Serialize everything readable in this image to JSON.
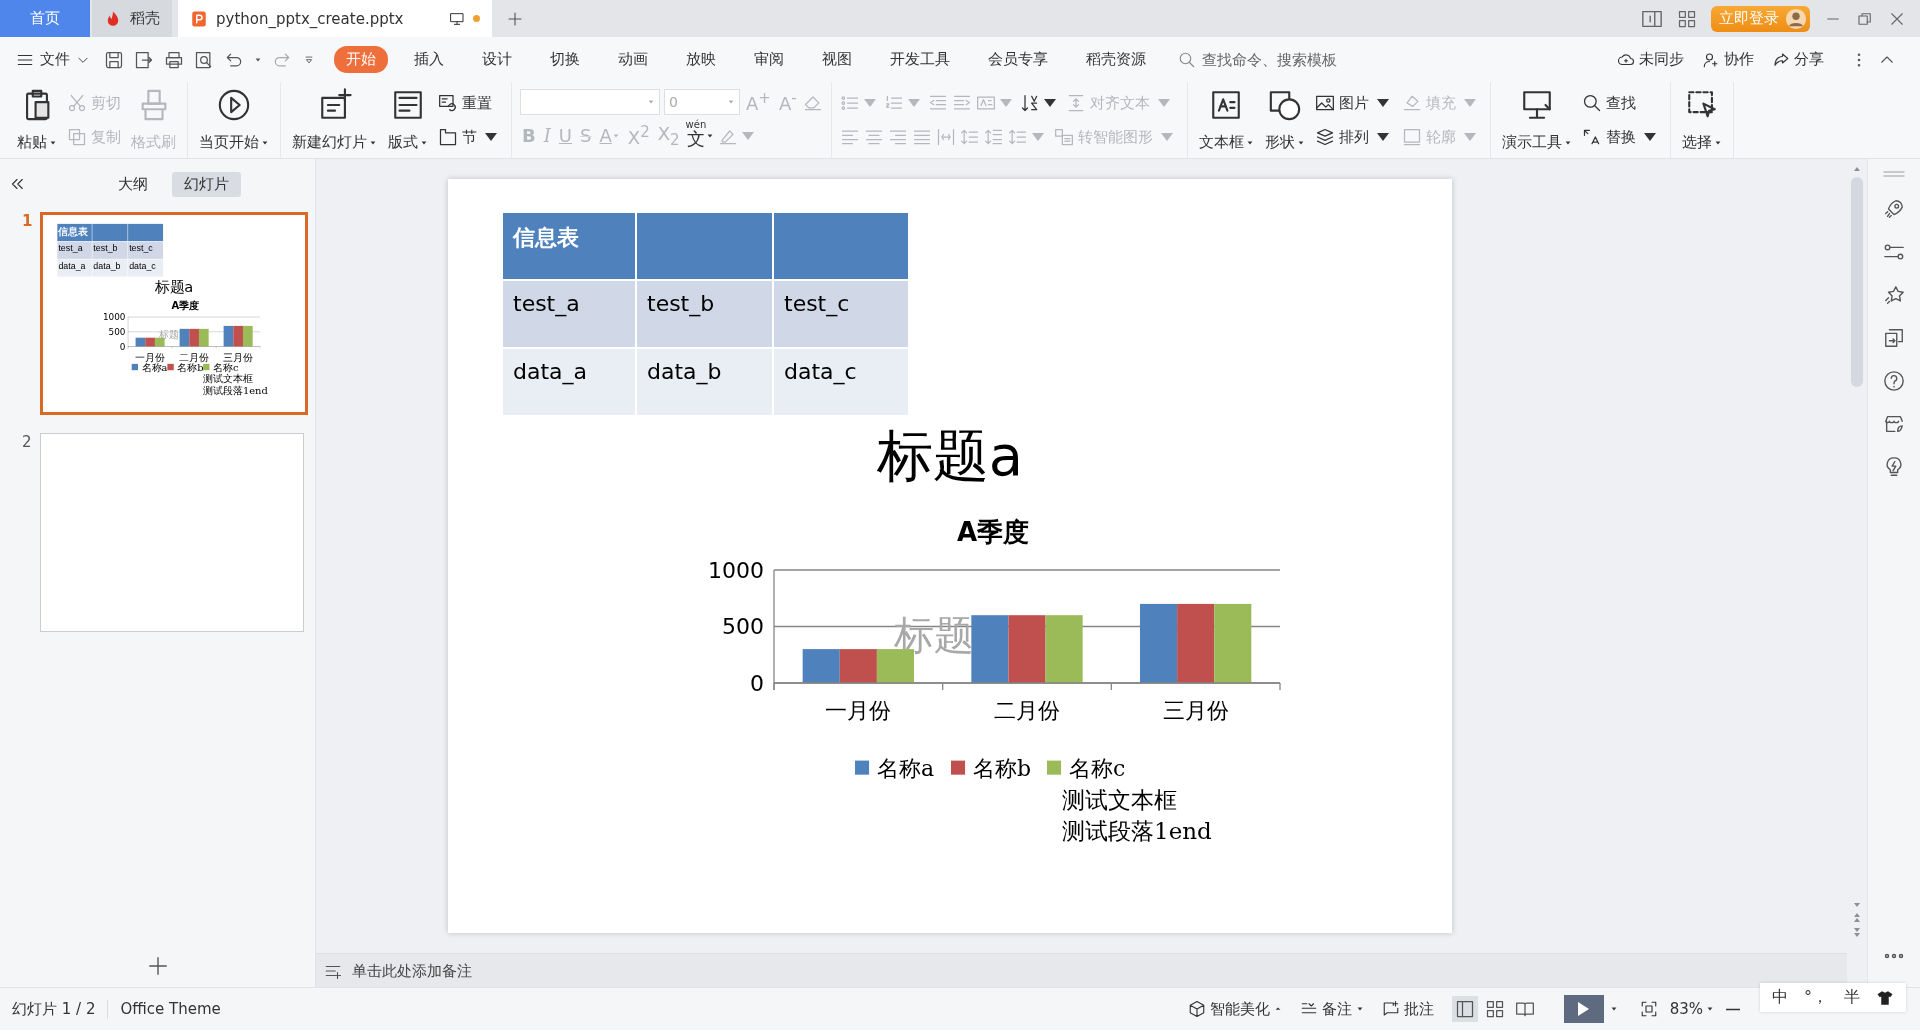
{
  "tabs": [
    {
      "label": "首页",
      "kind": "home",
      "selected": false,
      "modified": false
    },
    {
      "label": "稻壳",
      "kind": "app",
      "selected": false,
      "modified": false
    },
    {
      "label": "python_pptx_create.pptx",
      "kind": "document",
      "selected": true,
      "modified": true
    }
  ],
  "login": "立即登录",
  "menu": {
    "file": "文件",
    "tabs": [
      {
        "label": "开始",
        "selected": true
      },
      {
        "label": "插入",
        "selected": false
      },
      {
        "label": "设计",
        "selected": false
      },
      {
        "label": "切换",
        "selected": false
      },
      {
        "label": "动画",
        "selected": false
      },
      {
        "label": "放映",
        "selected": false
      },
      {
        "label": "审阅",
        "selected": false
      },
      {
        "label": "视图",
        "selected": false
      },
      {
        "label": "开发工具",
        "selected": false
      },
      {
        "label": "会员专享",
        "selected": false
      },
      {
        "label": "稻壳资源",
        "selected": false
      }
    ],
    "search": {
      "placeholder": "查找命令、搜索模板"
    },
    "actions": [
      "未同步",
      "协作",
      "分享"
    ]
  },
  "ribbon": [
    {
      "items": [
        {
          "kind": "large",
          "label": "粘贴",
          "dropdown": true,
          "disabled": false
        },
        {
          "kind": "column",
          "rows": [
            {
              "kind": "tools",
              "tools": [
                {
                  "kind": "small",
                  "label": "剪切",
                  "dropdown": false,
                  "disabled": true
                }
              ]
            },
            {
              "kind": "tools",
              "tools": [
                {
                  "kind": "small",
                  "label": "复制",
                  "dropdown": false,
                  "disabled": true
                }
              ]
            }
          ]
        },
        {
          "kind": "large",
          "label": "格式刷",
          "dropdown": false,
          "disabled": true
        }
      ]
    },
    {
      "items": [
        {
          "kind": "large",
          "label": "当页开始",
          "dropdown": true,
          "disabled": false
        }
      ]
    },
    {
      "items": [
        {
          "kind": "large",
          "label": "新建幻灯片",
          "dropdown": true,
          "disabled": false
        },
        {
          "kind": "large",
          "label": "版式",
          "dropdown": true,
          "disabled": false
        },
        {
          "kind": "column",
          "rows": [
            {
              "kind": "tools",
              "tools": [
                {
                  "kind": "small",
                  "label": "重置",
                  "dropdown": false,
                  "disabled": false
                }
              ]
            },
            {
              "kind": "tools",
              "tools": [
                {
                  "kind": "small",
                  "label": "节",
                  "dropdown": true,
                  "disabled": false
                }
              ]
            }
          ]
        }
      ]
    },
    {
      "items": [
        {
          "kind": "column",
          "rows": [
            {
              "kind": "tools",
              "tools": [
                {
                  "kind": "field",
                  "disabled": true
                },
                {
                  "kind": "field",
                  "value": "0",
                  "disabled": true
                },
                {
                  "kind": "glyph",
                  "text": "A$^{+}$",
                  "disabled": true,
                  "dropdown": false
                },
                {
                  "kind": "glyph",
                  "text": "A$^{-}$",
                  "disabled": true,
                  "dropdown": false
                },
                {
                  "kind": "icon",
                  "dropdown": false,
                  "disabled": true
                }
              ]
            },
            {
              "kind": "tools",
              "tools": [
                {
                  "kind": "glyph",
                  "text": "B",
                  "bold": true,
                  "disabled": true,
                  "dropdown": false
                },
                {
                  "kind": "glyph",
                  "text": "I",
                  "italic": true,
                  "disabled": true,
                  "dropdown": false
                },
                {
                  "kind": "glyph",
                  "text": "U",
                  "underline": true,
                  "disabled": true,
                  "dropdown": false
                },
                {
                  "kind": "glyph",
                  "text": "S",
                  "strike": true,
                  "disabled": true,
                  "dropdown": false
                },
                {
                  "kind": "glyph",
                  "text": "A",
                  "underline": true,
                  "disabled": true,
                  "dropdown": true
                },
                {
                  "kind": "glyph",
                  "text": "X$^{2}$",
                  "disabled": true,
                  "dropdown": false
                },
                {
                  "kind": "glyph",
                  "text": "X$_{2}$",
                  "disabled": true,
                  "dropdown": false
                },
                {
                  "kind": "ruby",
                  "text": "文",
                  "ruby": "wén",
                  "disabled": false,
                  "dropdown": true
                },
                {
                  "kind": "icon",
                  "dropdown": true,
                  "disabled": true
                }
              ]
            }
          ]
        }
      ]
    },
    {
      "items": [
        {
          "kind": "column",
          "rows": [
            {
              "kind": "tools",
              "tools": [
                {
                  "kind": "icon",
                  "dropdown": true,
                  "disabled": true
                },
                {
                  "kind": "icon",
                  "dropdown": true,
                  "disabled": true
                },
                {
                  "kind": "icon",
                  "dropdown": false,
                  "disabled": true
                },
                {
                  "kind": "icon",
                  "dropdown": false,
                  "disabled": true
                },
                {
                  "kind": "icon",
                  "dropdown": true,
                  "disabled": true
                },
                {
                  "kind": "icon",
                  "dropdown": true,
                  "disabled": false
                },
                {
                  "kind": "small",
                  "label": "对齐文本",
                  "dropdown": true,
                  "disabled": true
                }
              ]
            },
            {
              "kind": "tools",
              "tools": [
                {
                  "kind": "icon",
                  "dropdown": false,
                  "disabled": true
                },
                {
                  "kind": "icon",
                  "dropdown": false,
                  "disabled": true
                },
                {
                  "kind": "icon",
                  "dropdown": false,
                  "disabled": true
                },
                {
                  "kind": "icon",
                  "dropdown": false,
                  "disabled": true
                },
                {
                  "kind": "icon",
                  "dropdown": false,
                  "disabled": true
                },
                {
                  "kind": "icon",
                  "dropdown": false,
                  "disabled": true
                },
                {
                  "kind": "icon",
                  "dropdown": false,
                  "disabled": true
                },
                {
                  "kind": "icon",
                  "dropdown": true,
                  "disabled": true
                },
                {
                  "kind": "small",
                  "label": "转智能图形",
                  "dropdown": true,
                  "disabled": true
                }
              ]
            }
          ]
        }
      ]
    },
    {
      "items": [
        {
          "kind": "large",
          "label": "文本框",
          "dropdown": true,
          "disabled": false
        },
        {
          "kind": "large",
          "label": "形状",
          "dropdown": true,
          "disabled": false
        },
        {
          "kind": "column",
          "rows": [
            {
              "kind": "tools",
              "tools": [
                {
                  "kind": "small",
                  "label": "图片",
                  "dropdown": true,
                  "disabled": false
                }
              ]
            },
            {
              "kind": "tools",
              "tools": [
                {
                  "kind": "small",
                  "label": "排列",
                  "dropdown": true,
                  "disabled": false
                }
              ]
            }
          ]
        },
        {
          "kind": "column",
          "rows": [
            {
              "kind": "tools",
              "tools": [
                {
                  "kind": "small",
                  "label": "填充",
                  "dropdown": true,
                  "disabled": true
                }
              ]
            },
            {
              "kind": "tools",
              "tools": [
                {
                  "kind": "small",
                  "label": "轮廓",
                  "dropdown": true,
                  "disabled": true
                }
              ]
            }
          ]
        }
      ]
    },
    {
      "items": [
        {
          "kind": "large",
          "label": "演示工具",
          "dropdown": true,
          "disabled": false
        },
        {
          "kind": "column",
          "rows": [
            {
              "kind": "tools",
              "tools": [
                {
                  "kind": "small",
                  "label": "查找",
                  "dropdown": false,
                  "disabled": false
                }
              ]
            },
            {
              "kind": "tools",
              "tools": [
                {
                  "kind": "small",
                  "label": "替换",
                  "dropdown": true,
                  "disabled": false
                }
              ]
            }
          ]
        }
      ]
    },
    {
      "items": [
        {
          "kind": "large",
          "label": "选择",
          "dropdown": true,
          "disabled": false
        }
      ]
    }
  ],
  "panel": {
    "tabs": [
      {
        "label": "大纲",
        "selected": false
      },
      {
        "label": "幻灯片",
        "selected": true
      }
    ],
    "thumbnails": [
      {
        "number": "1",
        "selected": true,
        "slide": {
          "table": {
            "header": [
              {
                "kind": "text",
                "text": "信息表"
              },
              {
                "kind": "empty"
              },
              {
                "kind": "empty"
              }
            ],
            "rows": [
              [
                "test_a",
                "test_b",
                "test_c"
              ],
              [
                "data_a",
                "data_b",
                "data_c"
              ]
            ]
          },
          "title": "标题a",
          "faded_text": "标题",
          "chart_data": {
            "type": "bar",
            "title": "A季度",
            "categories": [
              "一月份",
              "二月份",
              "三月份"
            ],
            "ylim": [
              0,
              1000
            ],
            "yticks": [
              0,
              500,
              1000
            ],
            "legend": "bottom",
            "series": [
              {
                "name": "名称a",
                "color": "#4f81bd",
                "values": [
                  300,
                  600,
                  700
                ]
              },
              {
                "name": "名称b",
                "color": "#c0504d",
                "values": [
                  300,
                  600,
                  700
                ]
              },
              {
                "name": "名称c",
                "color": "#9bbb59",
                "values": [
                  300,
                  600,
                  700
                ]
              }
            ]
          },
          "text_box": [
            "测试文本框",
            "测试段落1end"
          ]
        }
      },
      {
        "number": "2",
        "selected": false
      }
    ]
  },
  "slide": {
    "table": {
      "header": [
        {
          "kind": "text",
          "text": "信息表"
        },
        {
          "kind": "empty"
        },
        {
          "kind": "empty"
        }
      ],
      "rows": [
        [
          "test_a",
          "test_b",
          "test_c"
        ],
        [
          "data_a",
          "data_b",
          "data_c"
        ]
      ]
    },
    "title": "标题a",
    "faded_text": "标题",
    "chart_data": {
      "type": "bar",
      "title": "A季度",
      "categories": [
        "一月份",
        "二月份",
        "三月份"
      ],
      "ylim": [
        0,
        1000
      ],
      "yticks": [
        0,
        500,
        1000
      ],
      "legend": "bottom",
      "series": [
        {
          "name": "名称a",
          "color": "#4f81bd",
          "values": [
            300,
            600,
            700
          ]
        },
        {
          "name": "名称b",
          "color": "#c0504d",
          "values": [
            300,
            600,
            700
          ]
        },
        {
          "name": "名称c",
          "color": "#9bbb59",
          "values": [
            300,
            600,
            700
          ]
        }
      ]
    },
    "text_box": [
      "测试文本框",
      "测试段落1end"
    ]
  },
  "notes": {
    "placeholder": "单击此处添加备注"
  },
  "status_bar": {
    "slide_info": "幻灯片 1 / 2",
    "theme": "Office Theme",
    "beautify": "智能美化",
    "notes": "备注",
    "comments": "批注",
    "views": [
      {
        "selected": true
      },
      {
        "selected": false
      },
      {
        "selected": false
      }
    ],
    "zoom": "83%"
  },
  "ime_bar": [
    "中",
    "°，",
    "半"
  ]
}
